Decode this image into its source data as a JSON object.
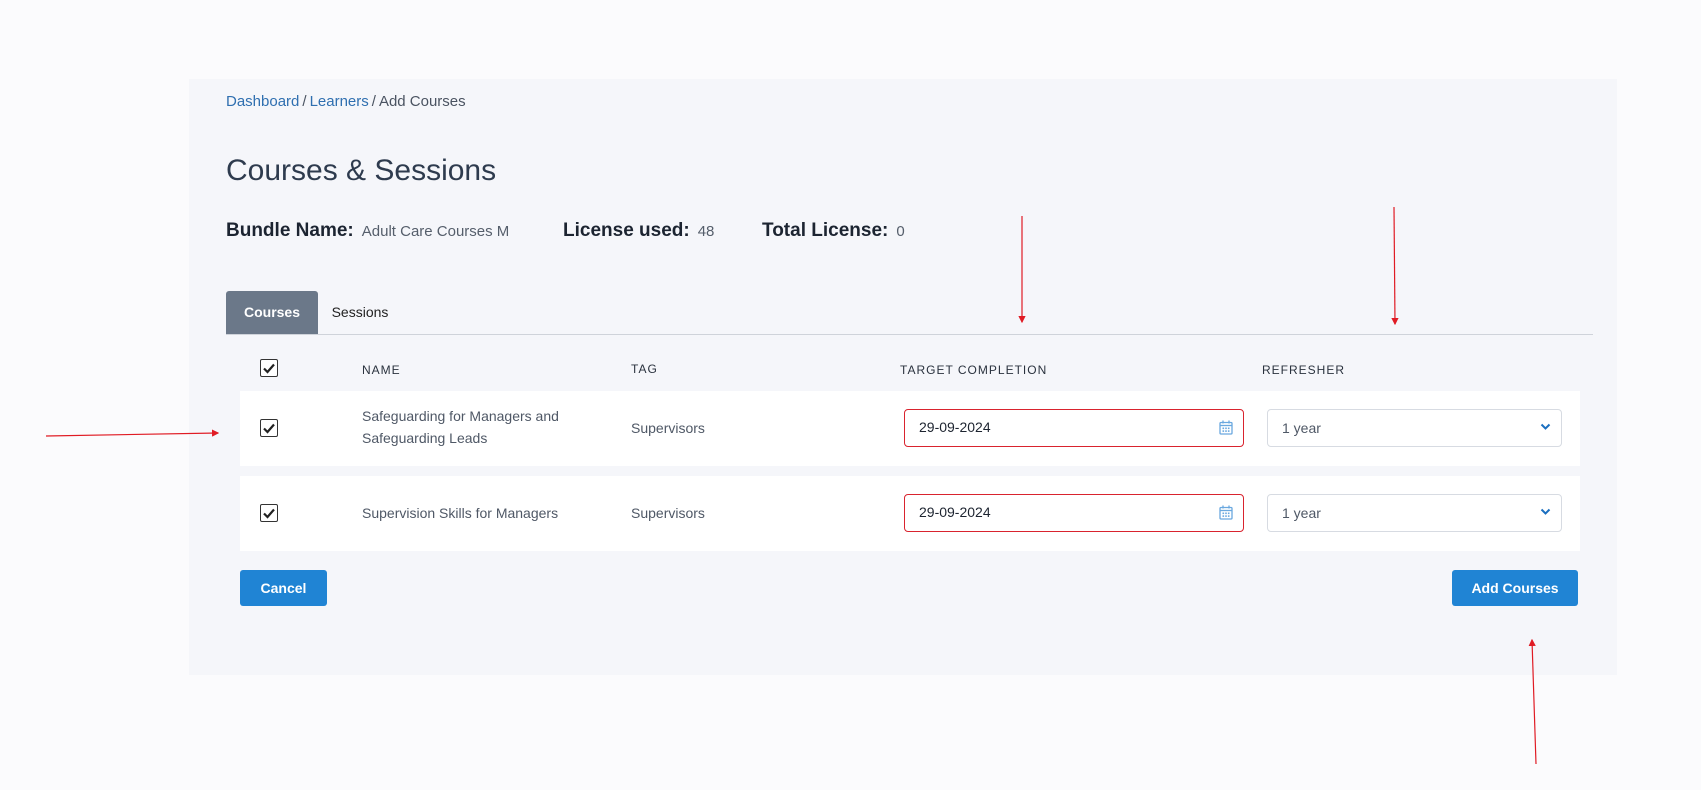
{
  "breadcrumb": {
    "items": [
      "Dashboard",
      "Learners",
      "Add Courses"
    ],
    "separator": "/"
  },
  "page": {
    "title": "Courses & Sessions"
  },
  "meta": {
    "bundle_label": "Bundle Name:",
    "bundle_value": "Adult Care Courses M",
    "license_used_label": "License used:",
    "license_used_value": "48",
    "total_license_label": "Total License:",
    "total_license_value": "0"
  },
  "tabs": [
    {
      "label": "Courses",
      "active": true
    },
    {
      "label": "Sessions",
      "active": false
    }
  ],
  "table": {
    "header_checked": true,
    "columns": [
      "NAME",
      "TAG",
      "TARGET COMPLETION",
      "REFRESHER"
    ],
    "rows": [
      {
        "checked": true,
        "name_line1": "Safeguarding for Managers and",
        "name_line2": "Safeguarding Leads",
        "tag": "Supervisors",
        "target_completion": "29-09-2024",
        "refresher": "1 year"
      },
      {
        "checked": true,
        "name_line1": "Supervision Skills for Managers",
        "name_line2": "",
        "tag": "Supervisors",
        "target_completion": "29-09-2024",
        "refresher": "1 year"
      }
    ]
  },
  "actions": {
    "cancel_label": "Cancel",
    "add_label": "Add Courses"
  },
  "colors": {
    "primary": "#2084d4",
    "error_border": "#d9232e",
    "tab_active": "#6b7889",
    "annotation_arrow": "#e01b24"
  },
  "icons": {
    "calendar": "calendar-icon",
    "dropdown": "chevron-down-icon",
    "check": "checkmark-icon"
  }
}
